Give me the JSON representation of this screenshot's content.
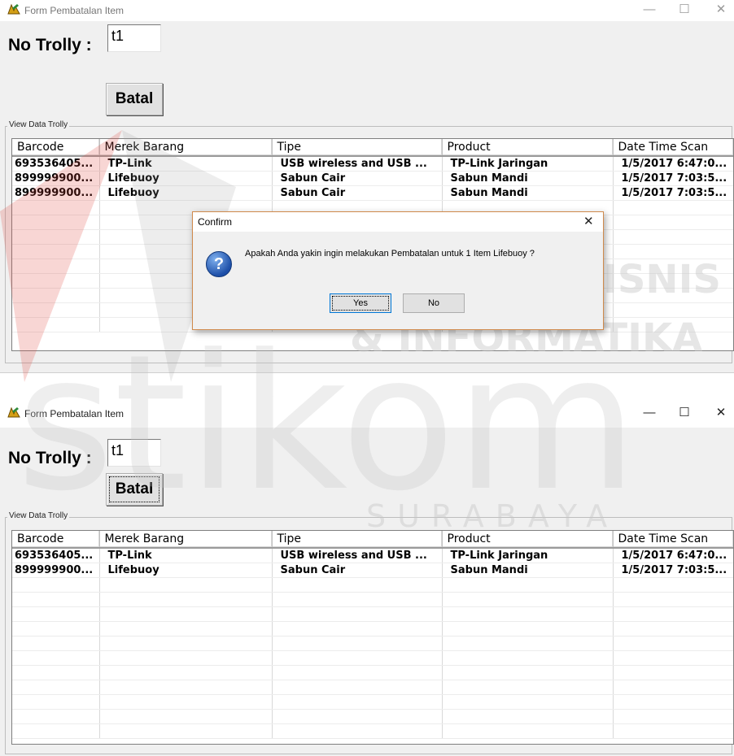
{
  "window_top": {
    "title": "Form Pembatalan Item",
    "controls": {
      "minimize": "—",
      "maximize": "☐",
      "close": "✕"
    },
    "trolly_label": "No Trolly :",
    "trolly_value": "t1",
    "batal_label": "Batal",
    "group_label": "View Data Trolly",
    "columns": [
      "Barcode",
      "Merek Barang",
      "Tipe",
      "Product",
      "Date Time Scan"
    ],
    "rows": [
      [
        "693536405...",
        "TP-Link",
        "USB wireless and USB ...",
        "TP-Link Jaringan",
        "1/5/2017 6:47:0..."
      ],
      [
        "899999900...",
        "Lifebuoy",
        "Sabun Cair",
        "Sabun Mandi",
        "1/5/2017 7:03:5..."
      ],
      [
        "899999900...",
        "Lifebuoy",
        "Sabun Cair",
        "Sabun Mandi",
        "1/5/2017 7:03:5..."
      ]
    ]
  },
  "dialog": {
    "title": "Confirm",
    "message": "Apakah Anda yakin ingin melakukan Pembatalan untuk 1 Item Lifebuoy ?",
    "yes_label": "Yes",
    "no_label": "No",
    "close": "✕",
    "icon": "question-icon"
  },
  "window_bottom": {
    "title": "Form Pembatalan Item",
    "controls": {
      "minimize": "—",
      "maximize": "☐",
      "close": "✕"
    },
    "trolly_label": "No Trolly :",
    "trolly_value": "t1",
    "batal_label": "Batal",
    "group_label": "View Data Trolly",
    "columns": [
      "Barcode",
      "Merek Barang",
      "Tipe",
      "Product",
      "Date Time Scan"
    ],
    "rows": [
      [
        "693536405...",
        "TP-Link",
        "USB wireless and USB ...",
        "TP-Link Jaringan",
        "1/5/2017 6:47:0..."
      ],
      [
        "899999900...",
        "Lifebuoy",
        "Sabun Cair",
        "Sabun Mandi",
        "1/5/2017 7:03:5..."
      ]
    ]
  },
  "watermark": {
    "line1": "INSTITUT BISNIS",
    "line2": "& INFORMATIKA",
    "brand": "stikom",
    "city": "SURABAYA",
    "color": "#d9d9d9",
    "accent": "#e0463c"
  }
}
